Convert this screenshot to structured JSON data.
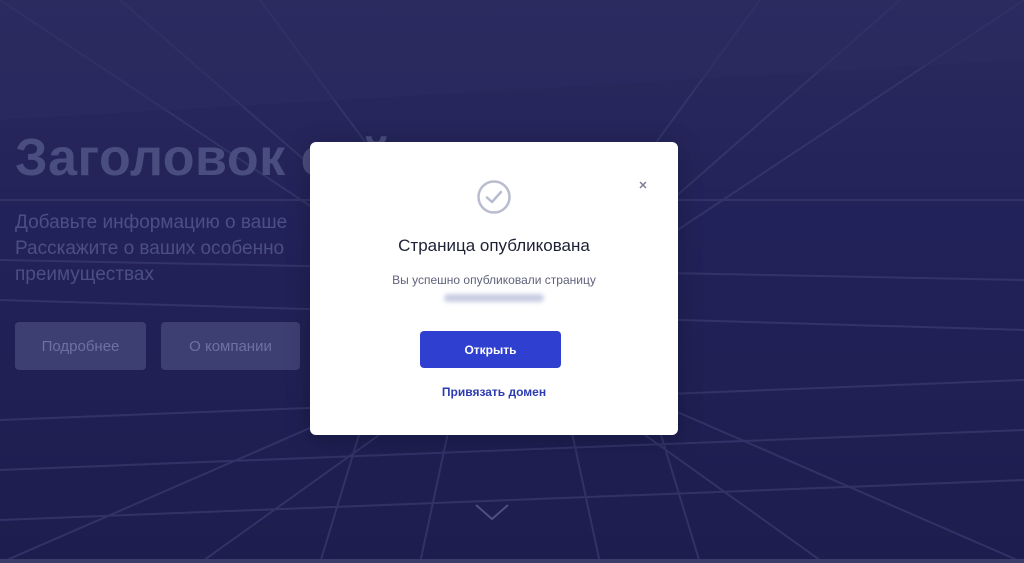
{
  "hero": {
    "title": "Заголовок сай",
    "subtitle_lines": [
      "Добавьте информацию о ваше",
      "Расскажите о ваших особенно",
      "преимуществах"
    ],
    "buttons": {
      "more": "Подробнее",
      "about": "О компании"
    }
  },
  "modal": {
    "title": "Страница опубликована",
    "message": "Вы успешно опубликовали страницу",
    "open_button": "Открыть",
    "link_domain": "Привязать домен",
    "close_symbol": "×"
  },
  "icons": {
    "status": "check-circle-icon",
    "close": "close-icon",
    "scroll": "chevron-down-icon"
  },
  "colors": {
    "overlay": "#1f1f4e",
    "accent": "#2f3fd0",
    "link": "#2c3cb0"
  }
}
